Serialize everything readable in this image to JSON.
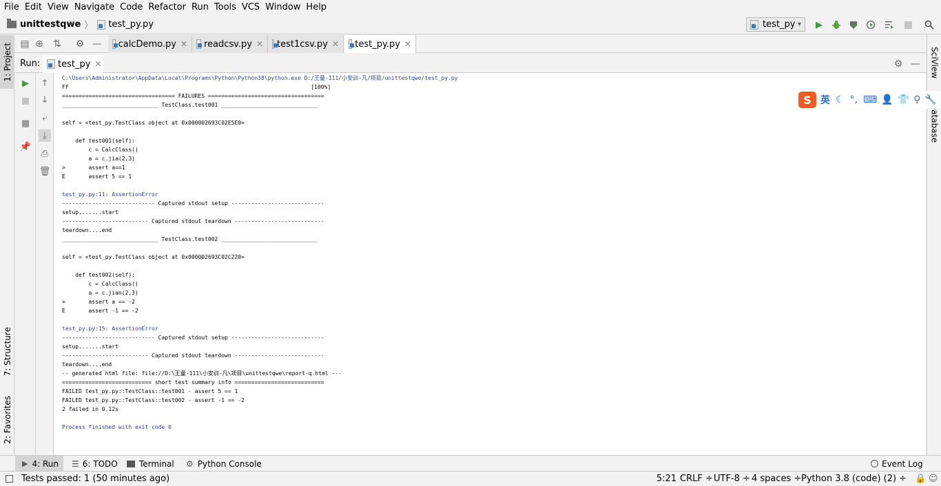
{
  "menu": [
    "File",
    "Edit",
    "View",
    "Navigate",
    "Code",
    "Refactor",
    "Run",
    "Tools",
    "VCS",
    "Window",
    "Help"
  ],
  "breadcrumb": {
    "project": "unittestqwe",
    "file": "test_py.py"
  },
  "run_config": {
    "name": "test_py"
  },
  "left_strip": {
    "project_tab": "1: Project",
    "structure_tab": "7: Structure",
    "favorites_tab": "2: Favorites"
  },
  "right_strip": {
    "sciview_tab": "SciView",
    "database_tab": "Database"
  },
  "editor_tabs": [
    {
      "label": "calcDemo.py"
    },
    {
      "label": "readcsv.py"
    },
    {
      "label": "test1csv.py"
    },
    {
      "label": "test_py.py",
      "active": true
    }
  ],
  "run_panel": {
    "label": "Run:",
    "tab": "test_py"
  },
  "console_lines": [
    {
      "text": "C:\\Users\\Administrator\\AppData\\Local\\Programs\\Python\\Python38\\python.exe D:/王童-111/小安训-凡/项目/unittestqwe/test_py.py",
      "color": "blue"
    },
    {
      "text": "FF                                                                         [100%]",
      "color": "black"
    },
    {
      "text": "================================== FAILURES ===================================",
      "color": "black"
    },
    {
      "text": "_____________________________ TestClass.test001 _____________________________",
      "color": "black"
    },
    {
      "text": "",
      "color": "black"
    },
    {
      "text": "self = <test_py.TestClass object at 0x000002693C02E5E0>",
      "color": "black"
    },
    {
      "text": "",
      "color": "black"
    },
    {
      "text": "    def test001(self):",
      "color": "black"
    },
    {
      "text": "        c = CalcClass()",
      "color": "black"
    },
    {
      "text": "        a = c.jia(2,3)",
      "color": "black"
    },
    {
      "text": ">       assert a==1",
      "color": "black"
    },
    {
      "text": "E       assert 5 == 1",
      "color": "black"
    },
    {
      "text": "",
      "color": "black"
    },
    {
      "text": "test_py.py:11: AssertionError",
      "color": "blue"
    },
    {
      "text": "---------------------------- Captured stdout setup ----------------------------",
      "color": "black"
    },
    {
      "text": "setup.......start",
      "color": "black"
    },
    {
      "text": "-------------------------- Captured stdout teardown ---------------------------",
      "color": "black"
    },
    {
      "text": "teardown....end",
      "color": "black"
    },
    {
      "text": "_____________________________ TestClass.test002 _____________________________",
      "color": "black"
    },
    {
      "text": "",
      "color": "black"
    },
    {
      "text": "self = <test_py.TestClass object at 0x000002693C02C220>",
      "color": "black"
    },
    {
      "text": "",
      "color": "black"
    },
    {
      "text": "    def test002(self):",
      "color": "black"
    },
    {
      "text": "        c = CalcClass()",
      "color": "black"
    },
    {
      "text": "        a = c.jian(2,3)",
      "color": "black"
    },
    {
      "text": ">       assert a == -2",
      "color": "black"
    },
    {
      "text": "E       assert -1 == -2",
      "color": "black"
    },
    {
      "text": "",
      "color": "black"
    },
    {
      "text": "test_py.py:15: AssertionError",
      "color": "blue"
    },
    {
      "text": "---------------------------- Captured stdout setup ----------------------------",
      "color": "black"
    },
    {
      "text": "setup.......start",
      "color": "black"
    },
    {
      "text": "-------------------------- Captured stdout teardown ---------------------------",
      "color": "black"
    },
    {
      "text": "teardown....end",
      "color": "black"
    },
    {
      "text": "-- generated html file: file://D:\\王童-111\\小安训-凡\\项目\\unittestqwe\\report-q.html ---",
      "color": "black"
    },
    {
      "text": "=========================== short test summary info ===========================",
      "color": "black"
    },
    {
      "text": "FAILED test_py.py::TestClass::test001 - assert 5 == 1",
      "color": "black"
    },
    {
      "text": "FAILED test_py.py::TestClass::test002 - assert -1 == -2",
      "color": "black"
    },
    {
      "text": "2 failed in 0.12s",
      "color": "black"
    },
    {
      "text": "",
      "color": "black"
    },
    {
      "text": "Process finished with exit code 0",
      "color": "blue"
    }
  ],
  "ime_toolbar": {
    "lang_label": "英"
  },
  "bottom_tabs": [
    {
      "label": "4: Run",
      "active": true
    },
    {
      "label": "6: TODO"
    },
    {
      "label": "Terminal"
    },
    {
      "label": "Python Console"
    },
    {
      "label": "Event Log"
    }
  ],
  "status": {
    "message": "Tests passed: 1 (50 minutes ago)",
    "position": "5:21",
    "line_sep": "CRLF ÷",
    "encoding": "UTF-8 ÷",
    "indent": "4 spaces ÷",
    "interpreter": "Python 3.8 (code) (2) ÷"
  },
  "colors": {
    "console_blue": "#2a3d9a",
    "run_green": "#3d9a3d",
    "ime_orange": "#f15a22",
    "ime_blue": "#2f72d6"
  }
}
